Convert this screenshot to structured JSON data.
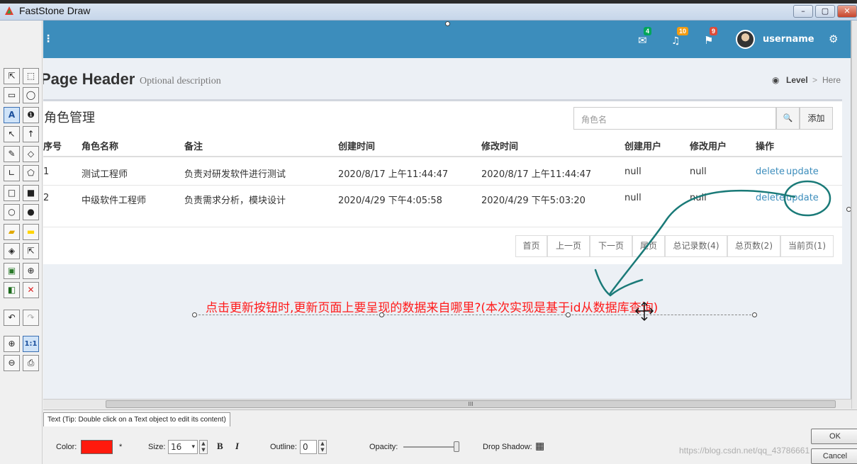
{
  "window": {
    "title": "FastStone Draw",
    "min": "–",
    "max": "▢",
    "close": "✕"
  },
  "tools": {
    "select_arrow": "⇱",
    "select_rect": "⬚",
    "callout_rect": "▭",
    "callout_round": "◯",
    "text": "A",
    "number": "❶",
    "arrow_line": "↖",
    "arrow_up": "↑",
    "pencil": "✎",
    "eraser": "◇",
    "polyline": "∟",
    "polygon": "⬠",
    "rect_outline": "□",
    "rect_fill": "■",
    "ellipse_outline": "○",
    "ellipse_fill": "●",
    "highlighter": "▰",
    "highlight_rect": "▬",
    "fill": "◈",
    "pointer_plus": "⇱",
    "image": "▣",
    "target": "⊕",
    "watermark": "◧",
    "delete": "✕",
    "undo": "↶",
    "redo": "↷",
    "zoom_in": "⊕",
    "zoom_actual": "1:1",
    "zoom_out": "⊖",
    "print": "⎙"
  },
  "web": {
    "menu": "⋮",
    "header": {
      "mail_badge": "4",
      "bell_badge": "10",
      "flag_badge": "9",
      "mail_icon": "✉",
      "bell_icon": "🔔",
      "flag_icon": "⚑",
      "gear_icon": "⚙",
      "username": "username"
    },
    "page_title": "Page Header",
    "page_description": "Optional description",
    "breadcrumb": {
      "level": "Level",
      "separator": ">",
      "here": "Here",
      "icon": "◉"
    },
    "box_title": "角色管理",
    "search_placeholder": "角色名",
    "search_icon": "🔍",
    "add_label": "添加",
    "columns": [
      "序号",
      "角色名称",
      "备注",
      "创建时间",
      "修改时间",
      "创建用户",
      "修改用户",
      "操作"
    ],
    "rows": [
      {
        "id": "1",
        "name": "测试工程师",
        "note": "负责对研发软件进行测试",
        "created": "2020/8/17 上午11:44:47",
        "modified": "2020/8/17 上午11:44:47",
        "creator": "null",
        "modifier": "null",
        "delete": "delete",
        "update": "update"
      },
      {
        "id": "2",
        "name": "中级软件工程师",
        "note": "负责需求分析，模块设计",
        "created": "2020/4/29 下午4:05:58",
        "modified": "2020/4/29 下午5:03:20",
        "creator": "null",
        "modifier": "null",
        "delete": "delete",
        "update": "update"
      }
    ],
    "pager": [
      "首页",
      "上一页",
      "下一页",
      "尾页",
      "总记录数(4)",
      "总页数(2)",
      "当前页(1)"
    ]
  },
  "annotation_text": "点击更新按钮时,更新页面上要呈现的数据来自哪里?(本次实现是基于id从数据库查询)",
  "scroll_grip": "III",
  "props": {
    "tab": "Text (Tip: Double click on a Text object to edit its content)",
    "color_label": "Color:",
    "color_value": "#ff1a0d",
    "color_star": "*",
    "size_label": "Size:",
    "size_value": "16",
    "size_arrow": "▾",
    "bold": "B",
    "italic": "I",
    "outline_label": "Outline:",
    "outline_value": "0",
    "opacity_label": "Opacity:",
    "opacity_fraction": 1.0,
    "shadow_label": "Drop Shadow:",
    "shadow_icon": "▦",
    "ok": "OK",
    "cancel": "Cancel"
  },
  "watermark": "https://blog.csdn.net/qq_43786661"
}
